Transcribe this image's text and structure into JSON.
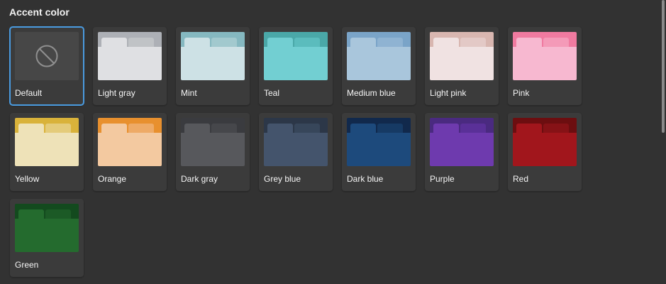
{
  "title": "Accent color",
  "selected": "Default",
  "swatches": [
    {
      "label": "Default",
      "icon": "none-icon"
    },
    {
      "label": "Light gray",
      "top": "#adb0b6",
      "tab": "#c0c3c6",
      "body": "#dfe0e3"
    },
    {
      "label": "Mint",
      "top": "#85b8c0",
      "tab": "#a2c9ce",
      "body": "#cde1e5"
    },
    {
      "label": "Teal",
      "top": "#4aa8a8",
      "tab": "#5bbcbd",
      "body": "#72cfd2"
    },
    {
      "label": "Medium blue",
      "top": "#7aa4c8",
      "tab": "#8fb3d2",
      "body": "#a9c6dc"
    },
    {
      "label": "Light pink",
      "top": "#d8b6b0",
      "tab": "#e3c9c6",
      "body": "#f0e2e2"
    },
    {
      "label": "Pink",
      "top": "#f07aa0",
      "tab": "#f49ab8",
      "body": "#f7b8d0"
    },
    {
      "label": "Yellow",
      "top": "#d9b23a",
      "tab": "#e4cb7a",
      "body": "#eee2b8"
    },
    {
      "label": "Orange",
      "top": "#e8902e",
      "tab": "#eeaa66",
      "body": "#f3c9a0"
    },
    {
      "label": "Dark gray",
      "top": "#3a3b3f",
      "tab": "#46474b",
      "body": "#57585c"
    },
    {
      "label": "Grey blue",
      "top": "#2c3748",
      "tab": "#37465a",
      "body": "#44546c"
    },
    {
      "label": "Dark blue",
      "top": "#11294c",
      "tab": "#163a64",
      "body": "#1d4a7c"
    },
    {
      "label": "Purple",
      "top": "#4a2a80",
      "tab": "#5a3098",
      "body": "#6e3aae"
    },
    {
      "label": "Red",
      "top": "#6c0e10",
      "tab": "#861216",
      "body": "#a1161c"
    },
    {
      "label": "Green",
      "top": "#134a1e",
      "tab": "#1c5a26",
      "body": "#246b2e"
    }
  ]
}
